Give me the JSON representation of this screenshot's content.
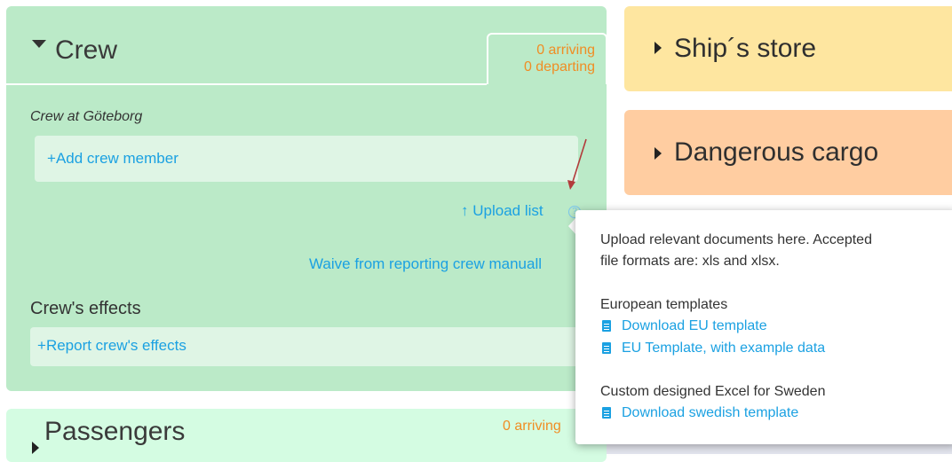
{
  "crew": {
    "title": "Crew",
    "arriving": "0 arriving",
    "departing": "0 departing",
    "location": "Crew at Göteborg",
    "add_member": "Add crew member",
    "upload_list": "Upload list",
    "waive": "Waive from reporting crew manuall",
    "effects_title": "Crew's effects",
    "report_effects": "Report crew's effects"
  },
  "ship_store": {
    "title": "Ship´s store"
  },
  "dangerous_cargo": {
    "title": "Dangerous cargo"
  },
  "passengers": {
    "title": "Passengers",
    "arriving": "0 arriving"
  },
  "tooltip": {
    "line1": "Upload relevant documents here. Accepted",
    "line2": "file formats are: xls and xlsx.",
    "european_heading": "European templates",
    "download_eu": "Download EU template",
    "eu_example": "EU Template, with example data",
    "custom_heading": "Custom designed Excel for Sweden",
    "download_swedish": "Download swedish template"
  },
  "icons": {
    "plus": "+",
    "upload": "↑",
    "help": "?"
  },
  "colors": {
    "crew_bg": "#bbeac8",
    "store_bg": "#fee6a0",
    "danger_bg": "#ffcda1",
    "passengers_bg": "#d4fce2",
    "link": "#1ba1e2",
    "count": "#f08d24",
    "annotation_arrow": "#b23b3b"
  }
}
